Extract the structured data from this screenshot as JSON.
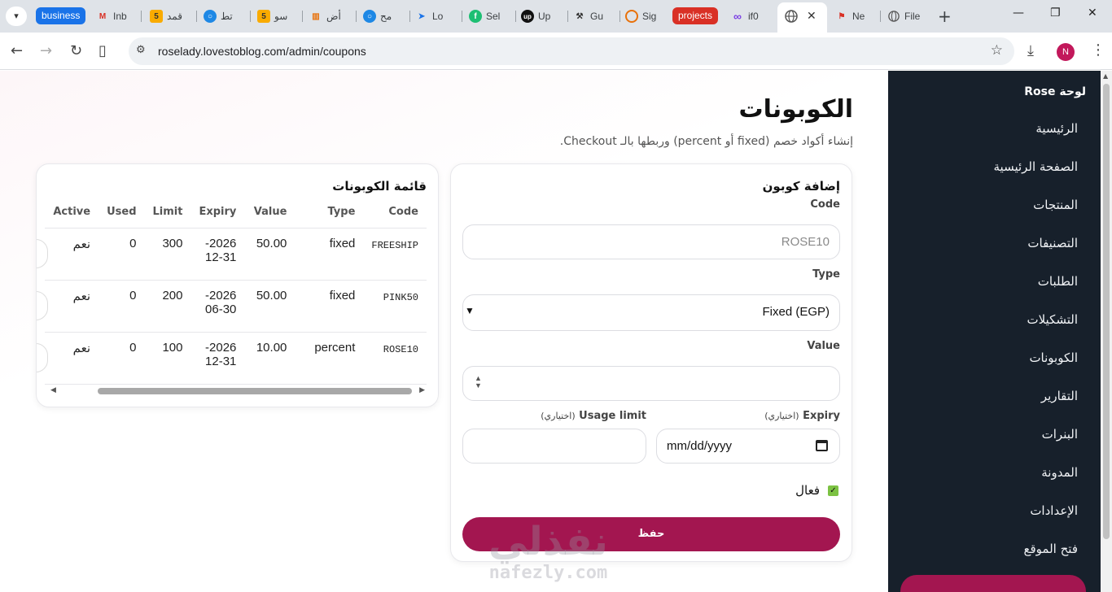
{
  "browser": {
    "tabs": [
      {
        "label": "business",
        "type": "chip",
        "color": "#1a73e8"
      },
      {
        "label": "Inb",
        "icon": "gmail-icon"
      },
      {
        "label": "قمد",
        "icon": "five-icon"
      },
      {
        "label": "تط",
        "icon": "circle-icon"
      },
      {
        "label": "سو",
        "icon": "five-icon"
      },
      {
        "label": "أض",
        "icon": "bar-icon"
      },
      {
        "label": "مح",
        "icon": "circle-icon"
      },
      {
        "label": "Lo",
        "icon": "arrow-icon"
      },
      {
        "label": "Sel",
        "icon": "fiverr-icon"
      },
      {
        "label": "Up",
        "icon": "upwork-icon"
      },
      {
        "label": "Gu",
        "icon": "tool-icon"
      },
      {
        "label": "Sig",
        "icon": "ring-icon"
      },
      {
        "label": "projects",
        "type": "chip",
        "color": "#d93025"
      },
      {
        "label": "if0",
        "icon": "infinity-icon"
      },
      {
        "label": "Ne",
        "icon": "flag-icon"
      },
      {
        "label": "File",
        "icon": "globe-icon"
      }
    ],
    "url": "roselady.lovestoblog.com/admin/coupons",
    "profile_initial": "N"
  },
  "sidebar": {
    "brand": "لوحة Rose",
    "items": [
      "الرئيسية",
      "الصفحة الرئيسية",
      "المنتجات",
      "التصنيفات",
      "الطلبات",
      "التشكيلات",
      "الكوبونات",
      "التقارير",
      "البنرات",
      "المدونة",
      "الإعدادات",
      "فتح الموقع"
    ]
  },
  "page": {
    "title": "الكوبونات",
    "subtitle": "إنشاء أكواد خصم (fixed أو percent) وربطها بالـ Checkout."
  },
  "form": {
    "title": "إضافة كوبون",
    "code_label": "Code",
    "code_placeholder": "ROSE10",
    "type_label": "Type",
    "type_value": "Fixed (EGP)",
    "value_label": "Value",
    "expiry_label": "Expiry",
    "expiry_optional": "(اختياري)",
    "expiry_placeholder": "mm/dd/yyyy",
    "usage_label": "Usage limit",
    "usage_optional": "(اختياري)",
    "active_label": "فعال",
    "active_checked": true,
    "save_label": "حفظ"
  },
  "table": {
    "title": "قائمة الكوبونات",
    "columns": [
      "Code",
      "Type",
      "Value",
      "Expiry",
      "Limit",
      "Used",
      "Active"
    ],
    "rows": [
      {
        "code": "FREESHIP",
        "type": "fixed",
        "value": "50.00",
        "expiry_a": "2026-",
        "expiry_b": "12-31",
        "limit": "300",
        "used": "0",
        "active": "نعم"
      },
      {
        "code": "PINK50",
        "type": "fixed",
        "value": "50.00",
        "expiry_a": "2026-",
        "expiry_b": "06-30",
        "limit": "200",
        "used": "0",
        "active": "نعم"
      },
      {
        "code": "ROSE10",
        "type": "percent",
        "value": "10.00",
        "expiry_a": "2026-",
        "expiry_b": "12-31",
        "limit": "100",
        "used": "0",
        "active": "نعم"
      }
    ]
  },
  "watermark": {
    "arabic": "نفذلي",
    "latin": "nafezly.com"
  },
  "colors": {
    "accent": "#a31650",
    "sidebar_bg": "#17202b",
    "check": "#7cc243"
  }
}
